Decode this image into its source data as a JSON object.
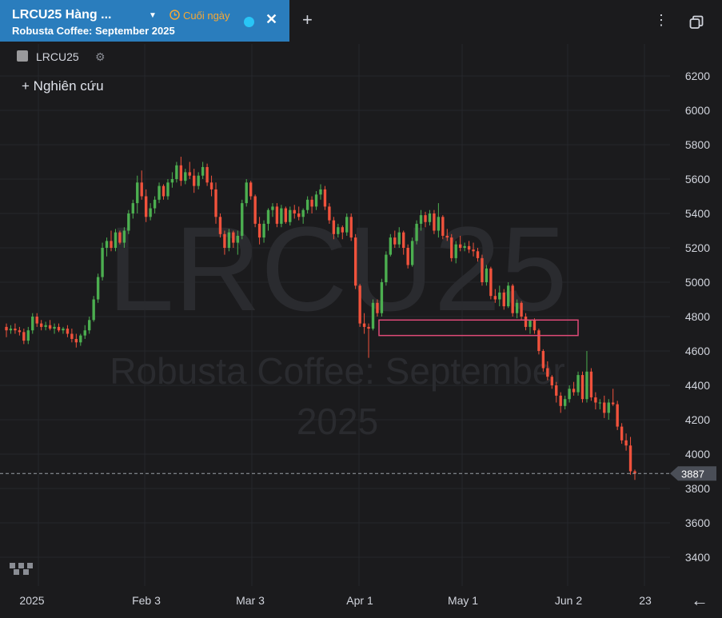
{
  "tab": {
    "title": "LRCU25 Hàng ...",
    "end_of_day": "Cuối ngày",
    "subtitle": "Robusta Coffee: September 2025",
    "status_color": "#29c5f6"
  },
  "toolbar": {
    "add_tab": "+",
    "more": "⋮"
  },
  "legend": {
    "symbol": "LRCU25",
    "study_button": "Nghiên cứu"
  },
  "watermark": {
    "symbol": "LRCU25",
    "line1": "Robusta Coffee: September",
    "line2": "2025"
  },
  "price_tag": "3887",
  "icons": [
    "caret-down-icon",
    "clock-icon",
    "close-icon",
    "plus-icon",
    "more-vert-icon",
    "window-icon",
    "gear-icon",
    "tv-logo-icon",
    "arrow-left-icon"
  ],
  "colors": {
    "up": "#4caf50",
    "down": "#f0523c",
    "zone": "#e04a78",
    "bg": "#1b1b1d",
    "tab": "#2a7dbd"
  },
  "chart_data": {
    "type": "candlestick",
    "y_ticks": [
      3400,
      3600,
      3800,
      4000,
      4200,
      4400,
      4600,
      4800,
      5000,
      5200,
      5400,
      5600,
      5800,
      6000,
      6200
    ],
    "ylim": [
      3280,
      6280
    ],
    "x_ticks": [
      "2025",
      "Feb 3",
      "Mar 3",
      "Apr 1",
      "May 1",
      "Jun 2",
      "23"
    ],
    "last_price": 3887,
    "zone": {
      "price_high": 4780,
      "price_low": 4690
    },
    "series": [
      [
        4740,
        4760,
        4680,
        4720
      ],
      [
        4720,
        4750,
        4700,
        4730
      ],
      [
        4730,
        4760,
        4700,
        4720
      ],
      [
        4720,
        4740,
        4690,
        4710
      ],
      [
        4710,
        4730,
        4640,
        4660
      ],
      [
        4660,
        4740,
        4640,
        4720
      ],
      [
        4720,
        4820,
        4700,
        4800
      ],
      [
        4800,
        4820,
        4740,
        4760
      ],
      [
        4760,
        4780,
        4720,
        4740
      ],
      [
        4740,
        4770,
        4720,
        4750
      ],
      [
        4750,
        4780,
        4720,
        4730
      ],
      [
        4730,
        4760,
        4700,
        4740
      ],
      [
        4740,
        4760,
        4710,
        4720
      ],
      [
        4720,
        4740,
        4700,
        4730
      ],
      [
        4730,
        4750,
        4680,
        4700
      ],
      [
        4700,
        4730,
        4650,
        4670
      ],
      [
        4670,
        4700,
        4620,
        4650
      ],
      [
        4650,
        4700,
        4630,
        4690
      ],
      [
        4690,
        4750,
        4670,
        4720
      ],
      [
        4720,
        4800,
        4700,
        4780
      ],
      [
        4780,
        4920,
        4770,
        4900
      ],
      [
        4900,
        5050,
        4880,
        5030
      ],
      [
        5030,
        5230,
        5010,
        5200
      ],
      [
        5200,
        5260,
        5150,
        5240
      ],
      [
        5240,
        5300,
        5180,
        5200
      ],
      [
        5200,
        5310,
        5180,
        5290
      ],
      [
        5290,
        5300,
        5220,
        5230
      ],
      [
        5230,
        5320,
        5200,
        5300
      ],
      [
        5300,
        5420,
        5280,
        5400
      ],
      [
        5400,
        5480,
        5370,
        5460
      ],
      [
        5460,
        5620,
        5400,
        5580
      ],
      [
        5580,
        5650,
        5480,
        5500
      ],
      [
        5500,
        5540,
        5350,
        5380
      ],
      [
        5380,
        5460,
        5360,
        5430
      ],
      [
        5430,
        5500,
        5400,
        5480
      ],
      [
        5480,
        5580,
        5460,
        5560
      ],
      [
        5560,
        5570,
        5480,
        5500
      ],
      [
        5500,
        5600,
        5480,
        5580
      ],
      [
        5580,
        5640,
        5550,
        5600
      ],
      [
        5600,
        5700,
        5580,
        5680
      ],
      [
        5680,
        5730,
        5560,
        5590
      ],
      [
        5590,
        5660,
        5570,
        5640
      ],
      [
        5640,
        5700,
        5600,
        5620
      ],
      [
        5620,
        5660,
        5520,
        5560
      ],
      [
        5560,
        5640,
        5540,
        5620
      ],
      [
        5620,
        5700,
        5600,
        5670
      ],
      [
        5670,
        5690,
        5560,
        5580
      ],
      [
        5580,
        5620,
        5500,
        5540
      ],
      [
        5540,
        5580,
        5340,
        5380
      ],
      [
        5380,
        5400,
        5260,
        5280
      ],
      [
        5280,
        5300,
        5160,
        5200
      ],
      [
        5200,
        5310,
        5180,
        5290
      ],
      [
        5290,
        5300,
        5200,
        5230
      ],
      [
        5230,
        5300,
        5160,
        5270
      ],
      [
        5270,
        5480,
        5250,
        5460
      ],
      [
        5460,
        5600,
        5440,
        5580
      ],
      [
        5580,
        5590,
        5480,
        5500
      ],
      [
        5500,
        5510,
        5320,
        5340
      ],
      [
        5340,
        5380,
        5220,
        5260
      ],
      [
        5260,
        5360,
        5230,
        5340
      ],
      [
        5340,
        5430,
        5300,
        5420
      ],
      [
        5420,
        5460,
        5380,
        5440
      ],
      [
        5440,
        5460,
        5320,
        5340
      ],
      [
        5340,
        5450,
        5320,
        5430
      ],
      [
        5430,
        5440,
        5340,
        5350
      ],
      [
        5350,
        5440,
        5330,
        5420
      ],
      [
        5420,
        5450,
        5370,
        5400
      ],
      [
        5400,
        5440,
        5360,
        5380
      ],
      [
        5380,
        5430,
        5340,
        5420
      ],
      [
        5420,
        5500,
        5400,
        5480
      ],
      [
        5480,
        5500,
        5400,
        5440
      ],
      [
        5440,
        5530,
        5420,
        5510
      ],
      [
        5510,
        5570,
        5480,
        5540
      ],
      [
        5540,
        5560,
        5420,
        5440
      ],
      [
        5440,
        5460,
        5340,
        5360
      ],
      [
        5360,
        5380,
        5250,
        5280
      ],
      [
        5280,
        5340,
        5260,
        5320
      ],
      [
        5320,
        5330,
        5250,
        5290
      ],
      [
        5290,
        5400,
        5270,
        5380
      ],
      [
        5380,
        5400,
        5240,
        5260
      ],
      [
        5260,
        5280,
        4960,
        4980
      ],
      [
        4980,
        4990,
        4740,
        4760
      ],
      [
        4760,
        4820,
        4700,
        4740
      ],
      [
        4740,
        4760,
        4560,
        4730
      ],
      [
        4730,
        4900,
        4720,
        4880
      ],
      [
        4880,
        4900,
        4800,
        4820
      ],
      [
        4820,
        5020,
        4800,
        5000
      ],
      [
        5000,
        5180,
        4980,
        5160
      ],
      [
        5160,
        5280,
        5150,
        5260
      ],
      [
        5260,
        5300,
        5200,
        5220
      ],
      [
        5220,
        5320,
        5200,
        5290
      ],
      [
        5290,
        5300,
        5160,
        5200
      ],
      [
        5200,
        5220,
        5080,
        5100
      ],
      [
        5100,
        5260,
        5090,
        5240
      ],
      [
        5240,
        5360,
        5220,
        5340
      ],
      [
        5340,
        5420,
        5300,
        5390
      ],
      [
        5390,
        5410,
        5320,
        5350
      ],
      [
        5350,
        5420,
        5330,
        5400
      ],
      [
        5400,
        5420,
        5280,
        5300
      ],
      [
        5300,
        5460,
        5260,
        5380
      ],
      [
        5380,
        5390,
        5250,
        5270
      ],
      [
        5270,
        5310,
        5240,
        5260
      ],
      [
        5260,
        5280,
        5120,
        5140
      ],
      [
        5140,
        5240,
        5110,
        5220
      ],
      [
        5220,
        5270,
        5180,
        5200
      ],
      [
        5200,
        5230,
        5180,
        5210
      ],
      [
        5210,
        5240,
        5170,
        5190
      ],
      [
        5190,
        5230,
        5150,
        5180
      ],
      [
        5180,
        5200,
        5120,
        5140
      ],
      [
        5140,
        5160,
        4980,
        5000
      ],
      [
        5000,
        5100,
        4980,
        5080
      ],
      [
        5080,
        5090,
        4900,
        4920
      ],
      [
        4920,
        4960,
        4880,
        4900
      ],
      [
        4900,
        4980,
        4860,
        4940
      ],
      [
        4940,
        4960,
        4840,
        4860
      ],
      [
        4860,
        5000,
        4850,
        4980
      ],
      [
        4980,
        4990,
        4800,
        4820
      ],
      [
        4820,
        4900,
        4790,
        4880
      ],
      [
        4880,
        4890,
        4780,
        4800
      ],
      [
        4800,
        4820,
        4720,
        4740
      ],
      [
        4740,
        4760,
        4700,
        4780
      ],
      [
        4780,
        4790,
        4700,
        4720
      ],
      [
        4720,
        4730,
        4580,
        4600
      ],
      [
        4600,
        4610,
        4480,
        4500
      ],
      [
        4500,
        4540,
        4430,
        4450
      ],
      [
        4450,
        4460,
        4380,
        4400
      ],
      [
        4400,
        4420,
        4300,
        4340
      ],
      [
        4340,
        4360,
        4240,
        4280
      ],
      [
        4280,
        4340,
        4260,
        4320
      ],
      [
        4320,
        4400,
        4300,
        4380
      ],
      [
        4380,
        4420,
        4340,
        4360
      ],
      [
        4360,
        4480,
        4340,
        4460
      ],
      [
        4460,
        4480,
        4300,
        4320
      ],
      [
        4320,
        4600,
        4300,
        4480
      ],
      [
        4480,
        4500,
        4310,
        4330
      ],
      [
        4330,
        4360,
        4260,
        4300
      ],
      [
        4300,
        4320,
        4260,
        4300
      ],
      [
        4300,
        4340,
        4210,
        4240
      ],
      [
        4240,
        4320,
        4200,
        4300
      ],
      [
        4300,
        4380,
        4280,
        4290
      ],
      [
        4290,
        4310,
        4140,
        4160
      ],
      [
        4160,
        4180,
        4060,
        4080
      ],
      [
        4080,
        4120,
        4020,
        4050
      ],
      [
        4050,
        4100,
        3880,
        3900
      ],
      [
        3900,
        3910,
        3850,
        3887
      ]
    ]
  }
}
